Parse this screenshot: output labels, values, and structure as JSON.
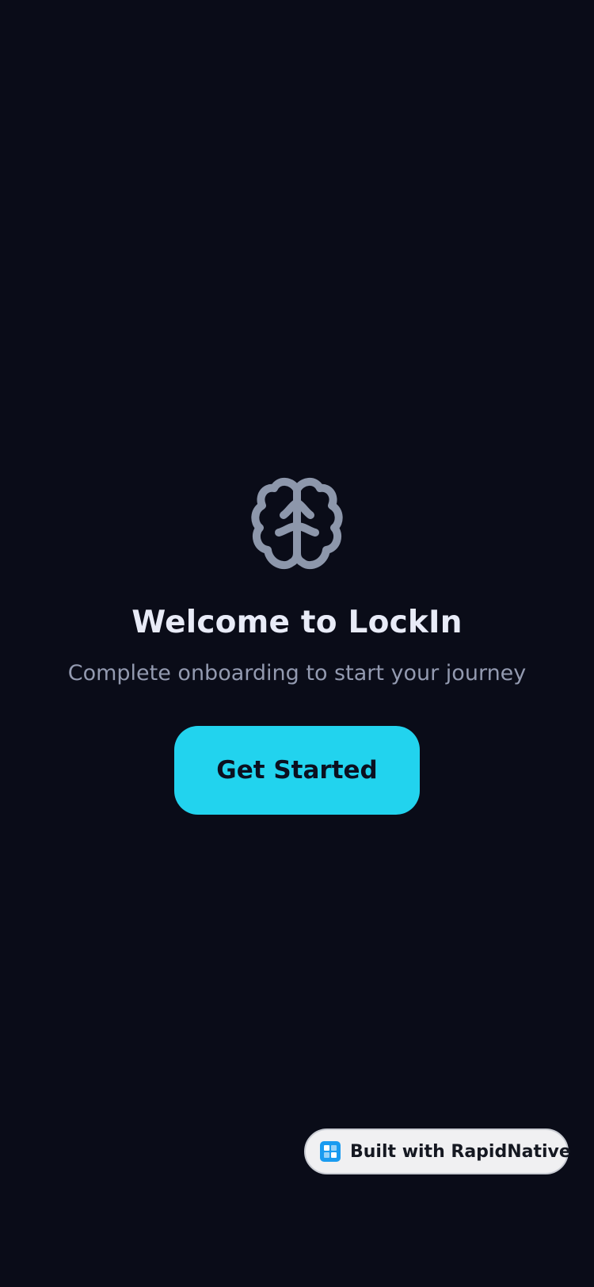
{
  "app": {
    "name": "LockIn"
  },
  "welcome": {
    "icon": "brain-icon",
    "title": "Welcome to LockIn",
    "subtitle": "Complete onboarding to start your journey",
    "button_label": "Get Started"
  },
  "badge": {
    "label": "Built with RapidNative",
    "icon": "rapidnative-logo-icon"
  },
  "colors": {
    "background": "#0a0c18",
    "accent": "#22d3ee",
    "icon": "#8d97ab",
    "title": "#e8ebf7",
    "subtitle": "#939ab0",
    "badge_background": "#f0f0f2",
    "badge_logo": "#1a9bf0"
  }
}
